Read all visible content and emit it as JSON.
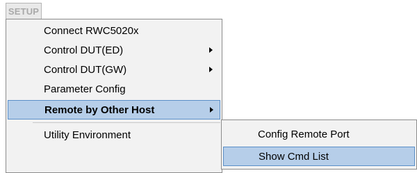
{
  "menubar": {
    "setup_label": "SETUP"
  },
  "setup_menu": {
    "items": [
      {
        "label": "Connect RWC5020x",
        "has_submenu": false
      },
      {
        "label": "Control DUT(ED)",
        "has_submenu": true
      },
      {
        "label": "Control DUT(GW)",
        "has_submenu": true
      },
      {
        "label": "Parameter Config",
        "has_submenu": false
      },
      {
        "label": "Remote by Other Host",
        "has_submenu": true,
        "highlighted": true
      },
      {
        "label": "Utility Environment",
        "has_submenu": false
      }
    ]
  },
  "remote_submenu": {
    "items": [
      {
        "label": "Config Remote Port"
      },
      {
        "label": "Show Cmd List",
        "highlighted": true
      }
    ]
  },
  "colors": {
    "highlight": "#b6cee9",
    "highlight_border": "#5a8fc8",
    "menu_background": "#f2f2f2"
  }
}
